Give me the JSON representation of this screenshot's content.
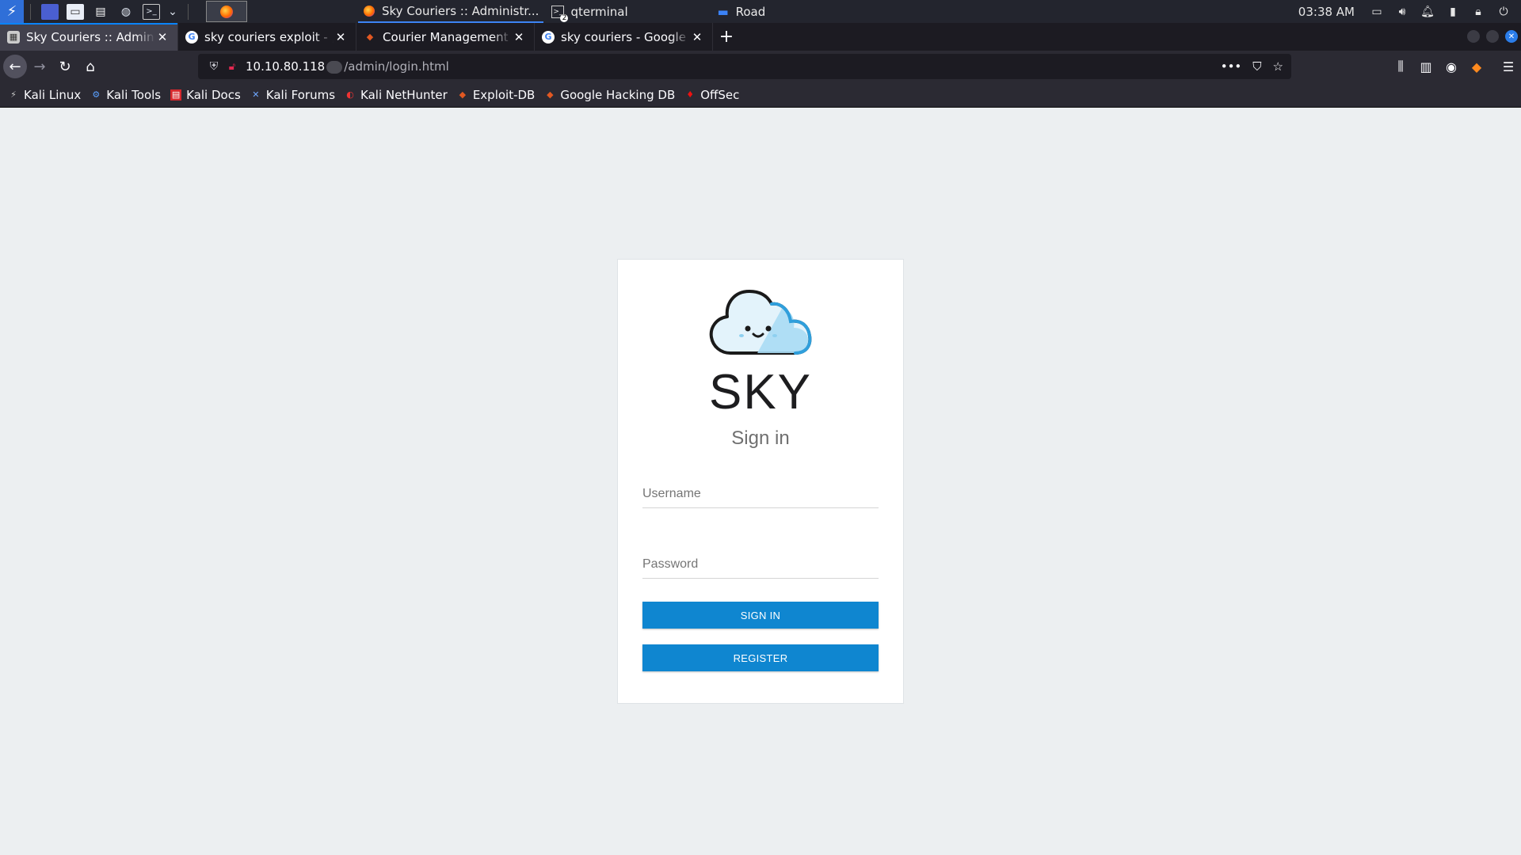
{
  "panel": {
    "tasks": [
      {
        "title": "Sky Couriers :: Administr...",
        "icon": "firefox-icon"
      },
      {
        "title": "qterminal",
        "icon": "terminal-icon"
      },
      {
        "title": "Road",
        "icon": "folder-icon"
      }
    ],
    "terminal_badge": "2",
    "clock": "03:38 AM"
  },
  "tabs": [
    {
      "title": "Sky Couriers :: Administr",
      "selected": true
    },
    {
      "title": "sky couriers exploit - „Go",
      "selected": false
    },
    {
      "title": "Courier Management Sys",
      "selected": false
    },
    {
      "title": "sky couriers - Google Sea",
      "selected": false
    }
  ],
  "url": {
    "host": "10.10.80.118",
    "path": "/admin/login.html"
  },
  "bookmarks": [
    {
      "label": "Kali Linux",
      "icon": "kali-icon"
    },
    {
      "label": "Kali Tools",
      "icon": "kali-tools-icon"
    },
    {
      "label": "Kali Docs",
      "icon": "kali-docs-icon"
    },
    {
      "label": "Kali Forums",
      "icon": "kali-forums-icon"
    },
    {
      "label": "Kali NetHunter",
      "icon": "nethunter-icon"
    },
    {
      "label": "Exploit-DB",
      "icon": "exploit-db-icon"
    },
    {
      "label": "Google Hacking DB",
      "icon": "ghdb-icon"
    },
    {
      "label": "OffSec",
      "icon": "offsec-icon"
    }
  ],
  "login": {
    "brand": "SKY",
    "title": "Sign in",
    "username_placeholder": "Username",
    "password_placeholder": "Password",
    "signin_label": "SIGN IN",
    "register_label": "REGISTER"
  },
  "colors": {
    "accent": "#0f86d0",
    "page_bg": "#eceff1",
    "browser_chrome": "#2b2a33"
  }
}
